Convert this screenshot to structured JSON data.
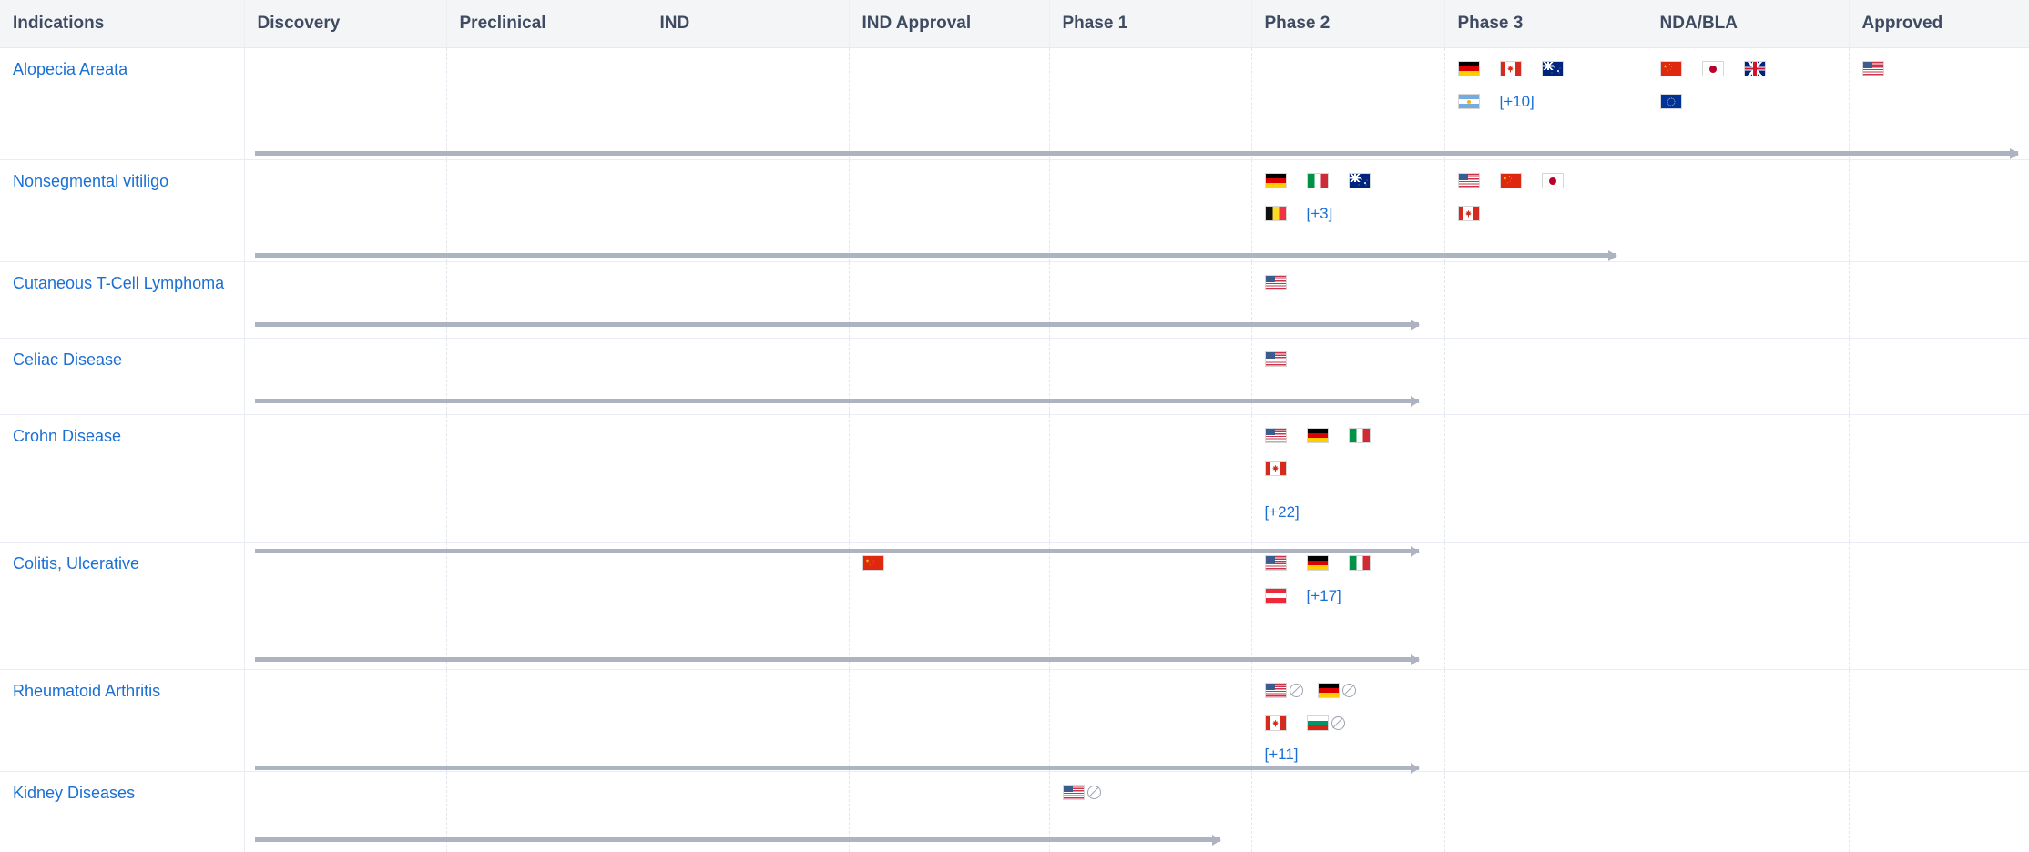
{
  "table": {
    "columns": [
      {
        "key": "indications",
        "label": "Indications"
      },
      {
        "key": "discovery",
        "label": "Discovery"
      },
      {
        "key": "preclinical",
        "label": "Preclinical"
      },
      {
        "key": "ind",
        "label": "IND"
      },
      {
        "key": "ind_approval",
        "label": "IND Approval"
      },
      {
        "key": "phase1",
        "label": "Phase 1"
      },
      {
        "key": "phase2",
        "label": "Phase 2"
      },
      {
        "key": "phase3",
        "label": "Phase 3"
      },
      {
        "key": "nda_bla",
        "label": "NDA/BLA"
      },
      {
        "key": "approved",
        "label": "Approved"
      }
    ],
    "link_color": "#1a6fd4",
    "header_text_color": "#3e4b61",
    "header_bg_color": "#f4f5f7",
    "arrow_color": "#aeb3c2",
    "rows": [
      {
        "indication": "Alopecia Areata",
        "cells": {
          "phase3": {
            "flags": [
              "Germany",
              "Canada",
              "Australia",
              "Argentina"
            ],
            "banned": [],
            "more": "[+10]"
          },
          "nda_bla": {
            "flags": [
              "China",
              "Japan",
              "United Kingdom",
              "European Union"
            ],
            "banned": [],
            "more": ""
          },
          "approved": {
            "flags": [
              "United States"
            ],
            "banned": [],
            "more": ""
          }
        }
      },
      {
        "indication": "Nonsegmental vitiligo",
        "cells": {
          "phase2": {
            "flags": [
              "Germany",
              "Italy",
              "Australia",
              "Belgium"
            ],
            "banned": [],
            "more": "[+3]"
          },
          "phase3": {
            "flags": [
              "United States",
              "China",
              "Japan",
              "Canada"
            ],
            "banned": [],
            "more": ""
          }
        }
      },
      {
        "indication": "Cutaneous T-Cell Lymphoma",
        "cells": {
          "phase2": {
            "flags": [
              "United States"
            ],
            "banned": [],
            "more": ""
          }
        }
      },
      {
        "indication": "Celiac Disease",
        "cells": {
          "phase2": {
            "flags": [
              "United States"
            ],
            "banned": [],
            "more": ""
          }
        }
      },
      {
        "indication": "Crohn Disease",
        "cells": {
          "phase2": {
            "flags": [
              "United States",
              "Germany",
              "Italy",
              "Canada"
            ],
            "banned": [],
            "more": "[+22]"
          }
        }
      },
      {
        "indication": "Colitis, Ulcerative",
        "cells": {
          "ind_approval": {
            "flags": [
              "China"
            ],
            "banned": [],
            "more": ""
          },
          "phase2": {
            "flags": [
              "United States",
              "Germany",
              "Italy",
              "Austria"
            ],
            "banned": [],
            "more": "[+17]"
          }
        }
      },
      {
        "indication": "Rheumatoid Arthritis",
        "cells": {
          "phase2": {
            "flags": [
              "United States",
              "Germany",
              "Canada",
              "Bulgaria"
            ],
            "banned": [
              "United States",
              "Germany",
              "Bulgaria"
            ],
            "more": "[+11]"
          }
        }
      },
      {
        "indication": "Kidney Diseases",
        "cells": {
          "phase1": {
            "flags": [
              "United States"
            ],
            "banned": [
              "United States"
            ],
            "more": ""
          }
        }
      }
    ]
  }
}
